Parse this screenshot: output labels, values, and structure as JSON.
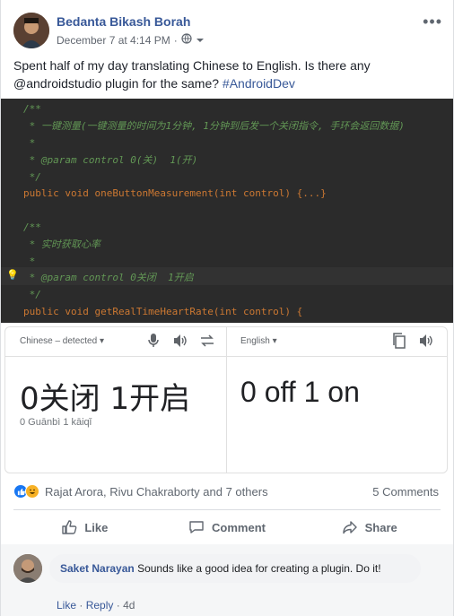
{
  "post": {
    "author": "Bedanta Bikash Borah",
    "timestamp": "December 7 at 4:14 PM",
    "text_prefix": "Spent half of my day translating Chinese to English. Is there any @androidstudio plugin for the same? ",
    "hashtag": "#AndroidDev"
  },
  "code": {
    "lines": [
      "/**",
      " * 一键测量(一键测量的时间为1分钟, 1分钟到后发一个关闭指令, 手环会返回数据)",
      " *",
      " * @param control 0(关)  1(开)",
      " */",
      "public void oneButtonMeasurement(int control) {...}",
      "",
      "/**",
      " * 实时获取心率",
      " *",
      " * @param control 0关闭  1开启",
      " */",
      "public void getRealTimeHeartRate(int control) {"
    ]
  },
  "translate": {
    "source_lang": "Chinese – detected",
    "target_lang": "English",
    "source_text": "0关闭  1开启",
    "source_pinyin": "0 Guānbì  1 kāiqǐ",
    "target_text": "0 off 1 on"
  },
  "reactions": {
    "names": "Rajat Arora, Rivu Chakraborty and 7 others",
    "comments_count": "5 Comments"
  },
  "actions": {
    "like": "Like",
    "comment": "Comment",
    "share": "Share"
  },
  "comment": {
    "author": "Saket Narayan",
    "text": "Sounds like a good idea for creating a plugin. Do it!",
    "like": "Like",
    "reply": "Reply",
    "age": "4d"
  },
  "colors": {
    "link": "#385898",
    "code_bg": "#2b2b2b"
  }
}
